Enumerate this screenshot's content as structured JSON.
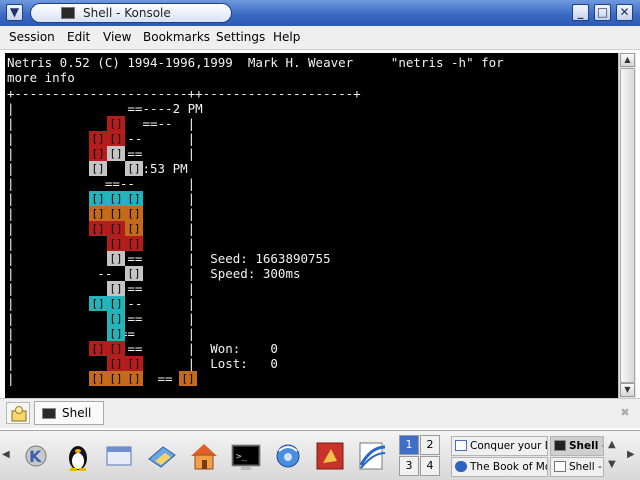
{
  "window": {
    "title": "Shell - Konsole",
    "title_icon": "terminal-icon",
    "buttons": {
      "menu": "▼",
      "minimize": "_",
      "maximize": "□",
      "close": "✕"
    }
  },
  "menu": [
    "Session",
    "Edit",
    "View",
    "Bookmarks",
    "Settings",
    "Help"
  ],
  "terminal": {
    "header_1": "Netris 0.52 (C) 1994-1996,1999  Mark H. Weaver     \"netris -h\" for",
    "header_2": "more info",
    "border_top": "+-----------------------++--------------------+",
    "text_rows": [
      "|               ==----2 PM",
      "|                 ==--  |",
      "|               --      |",
      "|               ==      |",
      "|          --   ==:53 PM",
      "|            ==--       |",
      "|               ==      |",
      "|               ==      |",
      "|               --      |",
      "|               ==      |",
      "|               ==      |  Seed: 1663890755",
      "|           --  ==      |  Speed: 300ms",
      "|            ---==      |",
      "|               --      |",
      "|               ==      |",
      "|            --==       |",
      "|               ==      |  Won:    0",
      "|               ==      |  Lost:   0",
      "|                   ==  |"
    ],
    "seed_label": "Seed: 1663890755",
    "speed_label": "Speed: 300ms",
    "won_label": "Won:    0",
    "lost_label": "Lost:   0",
    "block_glyph": "[]",
    "colors": {
      "red": "#b41d1d",
      "gray": "#c4c4c4",
      "cyan": "#25b2b8",
      "orange": "#c46a1c"
    }
  },
  "tabs": [
    {
      "label": "Shell",
      "icon": "terminal-icon"
    }
  ],
  "tab_row": {
    "new_session_icon": "new-session-icon",
    "close_icon": "close-tab-icon"
  },
  "taskbar": {
    "launchers": [
      "kde-menu-icon",
      "tux-icon",
      "window-list-icon",
      "desktop-icon",
      "home-icon",
      "terminal-icon",
      "browser-icon",
      "tools-icon",
      "office-icon"
    ],
    "pager": [
      "1",
      "2",
      "3",
      "4"
    ],
    "active_desktop": "1",
    "tasks": [
      {
        "label": "Conquer your D",
        "icon": "document-icon"
      },
      {
        "label": "Shell -",
        "icon": "terminal-icon",
        "active": true
      },
      {
        "label": "The Book of Mo",
        "icon": "globe-icon"
      },
      {
        "label": "Shell -",
        "icon": "terminal-icon"
      }
    ]
  }
}
